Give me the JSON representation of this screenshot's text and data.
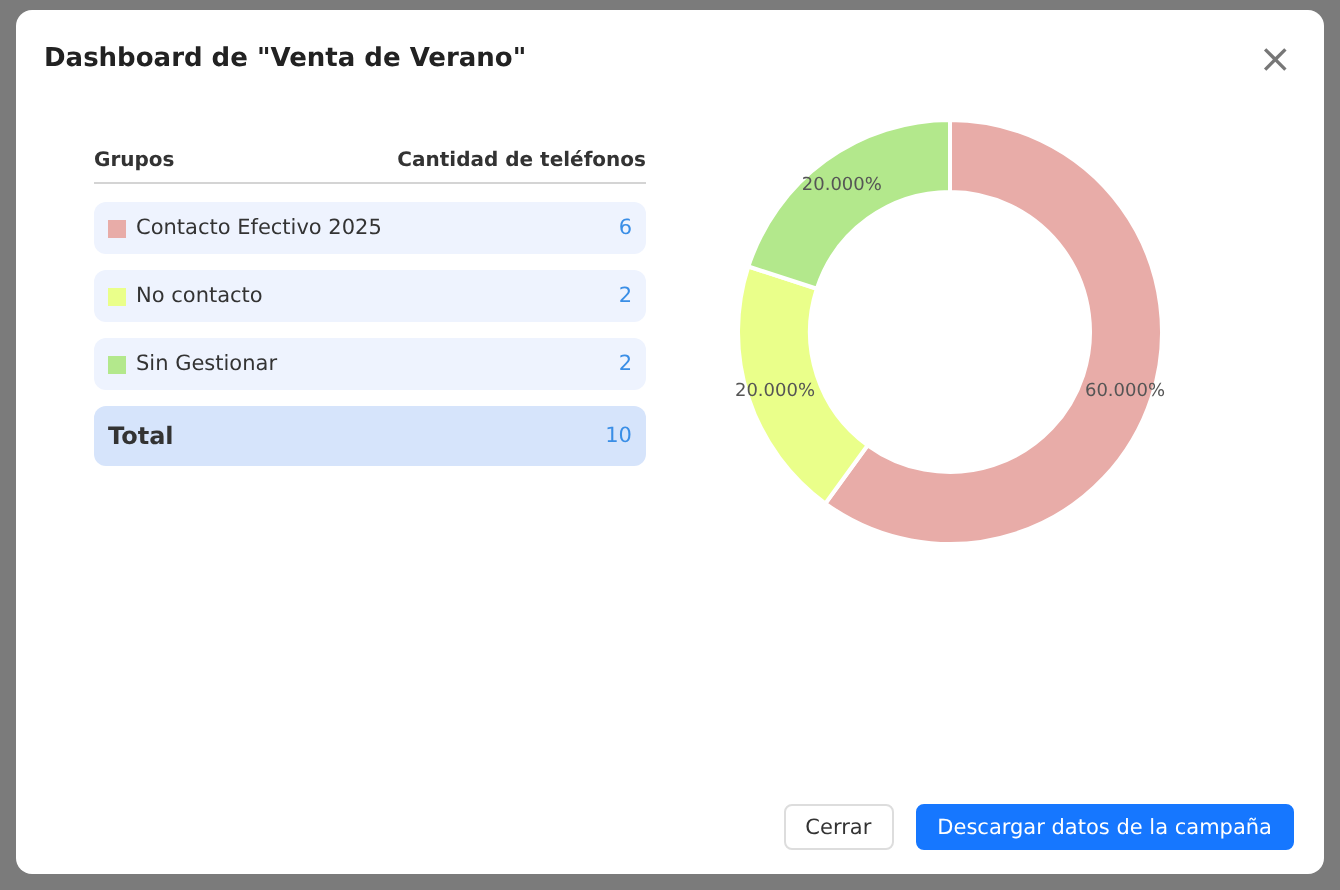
{
  "dialog": {
    "title": "Dashboard de \"Venta de Verano\"",
    "close": "×"
  },
  "groups_table": {
    "columns": [
      "Grupos",
      "Cantidad de teléfonos"
    ],
    "rows": [
      {
        "name": "Contacto Efectivo 2025",
        "count": "6",
        "color": "#e8aca8"
      },
      {
        "name": "No contacto",
        "count": "2",
        "color": "#eaff8a"
      },
      {
        "name": "Sin Gestionar",
        "count": "2",
        "color": "#b3e88c"
      }
    ],
    "total": {
      "label": "Total",
      "count": "10"
    }
  },
  "chart_data": {
    "type": "donut",
    "values": [
      60,
      20,
      20
    ],
    "value_labels": [
      "60.000%",
      "20.000%",
      "20.000%"
    ]
  },
  "buttons": [
    {
      "label": "Cerrar",
      "kind": "secondary"
    },
    {
      "label": "Descargar datos de la campaña",
      "kind": "primary"
    }
  ]
}
